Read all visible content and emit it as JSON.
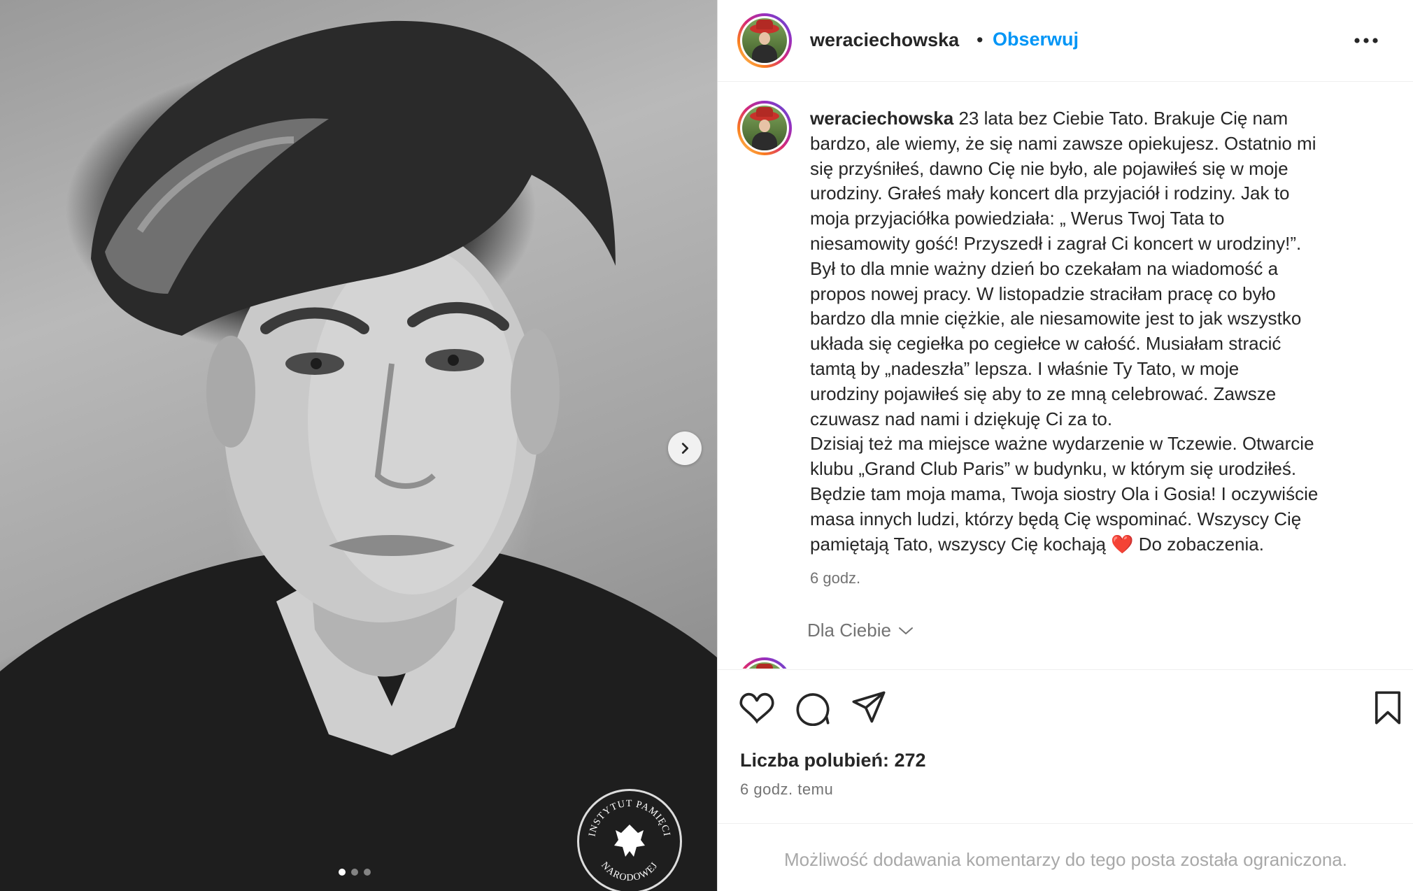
{
  "post": {
    "username": "weraciechowska",
    "separator": "•",
    "follow_label": "Obserwuj",
    "caption_user": "weraciechowska",
    "caption_text": " 23 lata bez Ciebie Tato. Brakuje Cię nam\nbardzo, ale wiemy, że się nami zawsze opiekujesz. Ostatnio mi\nsię przyśniłeś, dawno Cię nie było, ale pojawiłeś się w moje\nurodziny. Grałeś mały koncert dla przyjaciół i rodziny. Jak to\nmoja przyjaciółka powiedziała: „ Werus Twoj Tata to\nniesamowity gość! Przyszedł i zagrał Ci koncert w urodziny!”.\nBył to dla mnie ważny dzień bo czekałam na wiadomość a\npropos nowej pracy. W listopadzie straciłam pracę co było\nbardzo dla mnie ciężkie, ale niesamowite jest to jak wszystko\nukłada się cegiełka po cegiełce w całość. Musiałam stracić\ntamtą by „nadeszła” lepsza. I właśnie Ty Tato, w moje\nurodziny pojawiłeś się aby to ze mną celebrować. Zawsze\nczuwasz nad nami i dziękuję Ci za to.\nDzisiaj też ma miejsce ważne wydarzenie w Tczewie. Otwarcie\nklubu „Grand Club Paris” w budynku, w którym się urodziłeś.\nBędzie tam moja mama, Twoja siostry Ola i Gosia! I oczywiście\nmasa innych ludzi, którzy będą Cię wspominać. Wszyscy Cię\npamiętają Tato, wszyscy Cię kochają ❤️ Do zobaczenia.",
    "caption_time": "6 godz.",
    "for_you_label": "Dla Ciebie",
    "likes_label": "Liczba polubień: 272",
    "post_time": "6 godz. temu",
    "comments_disabled": "Możliwość dodawania komentarzy do tego posta została ograniczona."
  },
  "media": {
    "slide_count": 3,
    "active_slide": 1,
    "seal_text_top": "INSTYTUT PAMIĘCI",
    "seal_text_bottom": "NARODOWEJ"
  },
  "icons": {
    "more": "more-options-icon",
    "like": "heart-icon",
    "comment": "comment-icon",
    "share": "share-icon",
    "save": "bookmark-icon",
    "next": "chevron-right-icon",
    "dropdown": "chevron-down-icon"
  },
  "colors": {
    "accent": "#0095f6",
    "text": "#262626",
    "muted": "#737373",
    "placeholder": "#a8a8a8",
    "heart": "#e0245e"
  }
}
